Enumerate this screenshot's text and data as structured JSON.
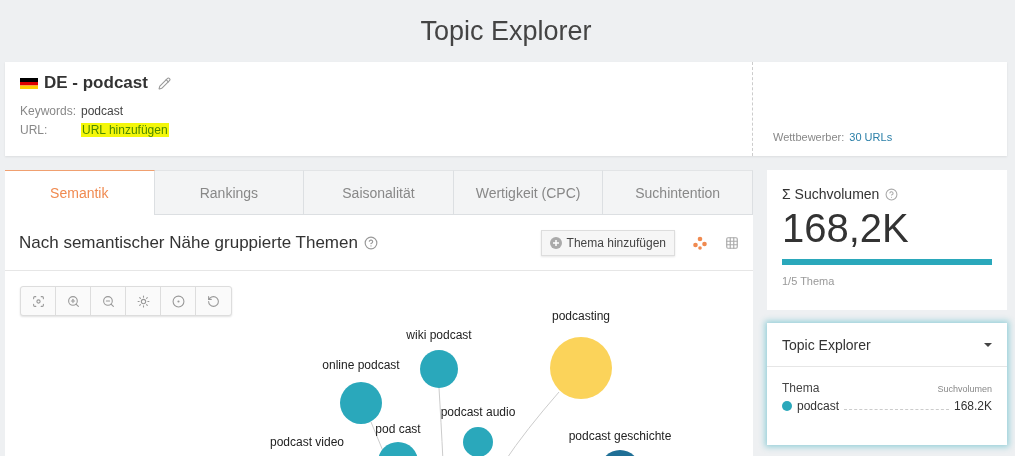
{
  "page_title": "Topic Explorer",
  "project": {
    "title": "DE - podcast",
    "keywords_label": "Keywords:",
    "keywords": "podcast",
    "url_label": "URL:",
    "url_link": "URL hinzufügen",
    "competitors_label": "Wettbewerber:",
    "competitors_link": "30 URLs"
  },
  "tabs": [
    {
      "label": "Semantik",
      "selected": true
    },
    {
      "label": "Rankings",
      "selected": false
    },
    {
      "label": "Saisonalität",
      "selected": false
    },
    {
      "label": "Wertigkeit (CPC)",
      "selected": false
    },
    {
      "label": "Suchintention",
      "selected": false
    }
  ],
  "section": {
    "heading": "Nach semantischer Nähe gruppierte Themen",
    "add_button": "Thema hinzufügen"
  },
  "graph_nodes": [
    {
      "label": "podcasting",
      "color": "#fbd35a"
    },
    {
      "label": "wiki podcast",
      "color": "#2aa8bb"
    },
    {
      "label": "online podcast",
      "color": "#2aa8bb"
    },
    {
      "label": "podcast audio",
      "color": "#2aa8bb"
    },
    {
      "label": "pod cast",
      "color": "#2aa8bb"
    },
    {
      "label": "podcast geschichte",
      "color": "#1f6f96"
    },
    {
      "label": "podcast video"
    }
  ],
  "volume_card": {
    "title": "Σ Suchvolumen",
    "value": "168,2K",
    "level": 1,
    "caption": "1/5 Thema"
  },
  "topic_card": {
    "title": "Topic Explorer",
    "col_topic": "Thema",
    "col_volume": "Suchvolumen",
    "rows": [
      {
        "name": "podcast",
        "value": "168.2K",
        "color": "#2aa8bb"
      }
    ]
  }
}
